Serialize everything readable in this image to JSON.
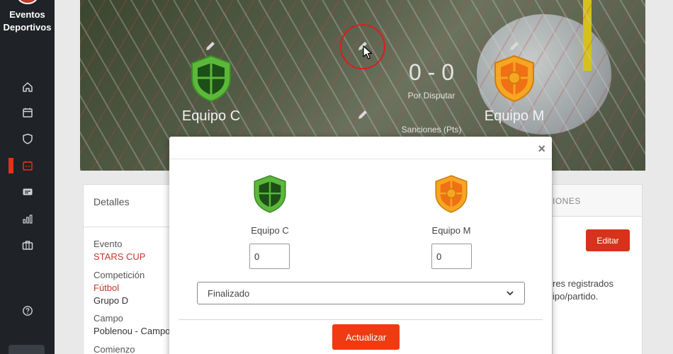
{
  "brand": {
    "line1": "Eventos",
    "line2": "Deportivos"
  },
  "sidebar": {
    "items": [
      {
        "icon": "home-icon"
      },
      {
        "icon": "calendar-icon"
      },
      {
        "icon": "shield-icon"
      },
      {
        "icon": "calendar-match-icon",
        "active": true
      },
      {
        "icon": "id-card-icon"
      },
      {
        "icon": "bar-chart-icon"
      },
      {
        "icon": "briefcase-icon"
      }
    ],
    "help_icon": "help-icon"
  },
  "match": {
    "home_team": "Equipo C",
    "away_team": "Equipo M",
    "score": "0 - 0",
    "status": "Por Disputar",
    "sanctions_label": "Sanciones (Pts)"
  },
  "details": {
    "heading": "Detalles",
    "event_label": "Evento",
    "event_value": "STARS CUP",
    "competition_label": "Competición",
    "competition_value": "Fútbol",
    "group_value": "Grupo D",
    "venue_label": "Campo",
    "venue_value": "Poblenou - Campo",
    "start_label": "Comienzo"
  },
  "right_card": {
    "tab_label": "IONES",
    "edit_label": "Editar",
    "note_line1": "res registrados",
    "note_line2": "ipo/partido."
  },
  "modal": {
    "close_label": "×",
    "home_team": "Equipo C",
    "away_team": "Equipo M",
    "home_score": "0",
    "away_score": "0",
    "status_selected": "Finalizado",
    "update_label": "Actualizar"
  },
  "colors": {
    "accent": "#f03b12",
    "sidebar": "#1f2227",
    "home_shield": "#5cb83a",
    "away_shield": "#f5a623"
  }
}
